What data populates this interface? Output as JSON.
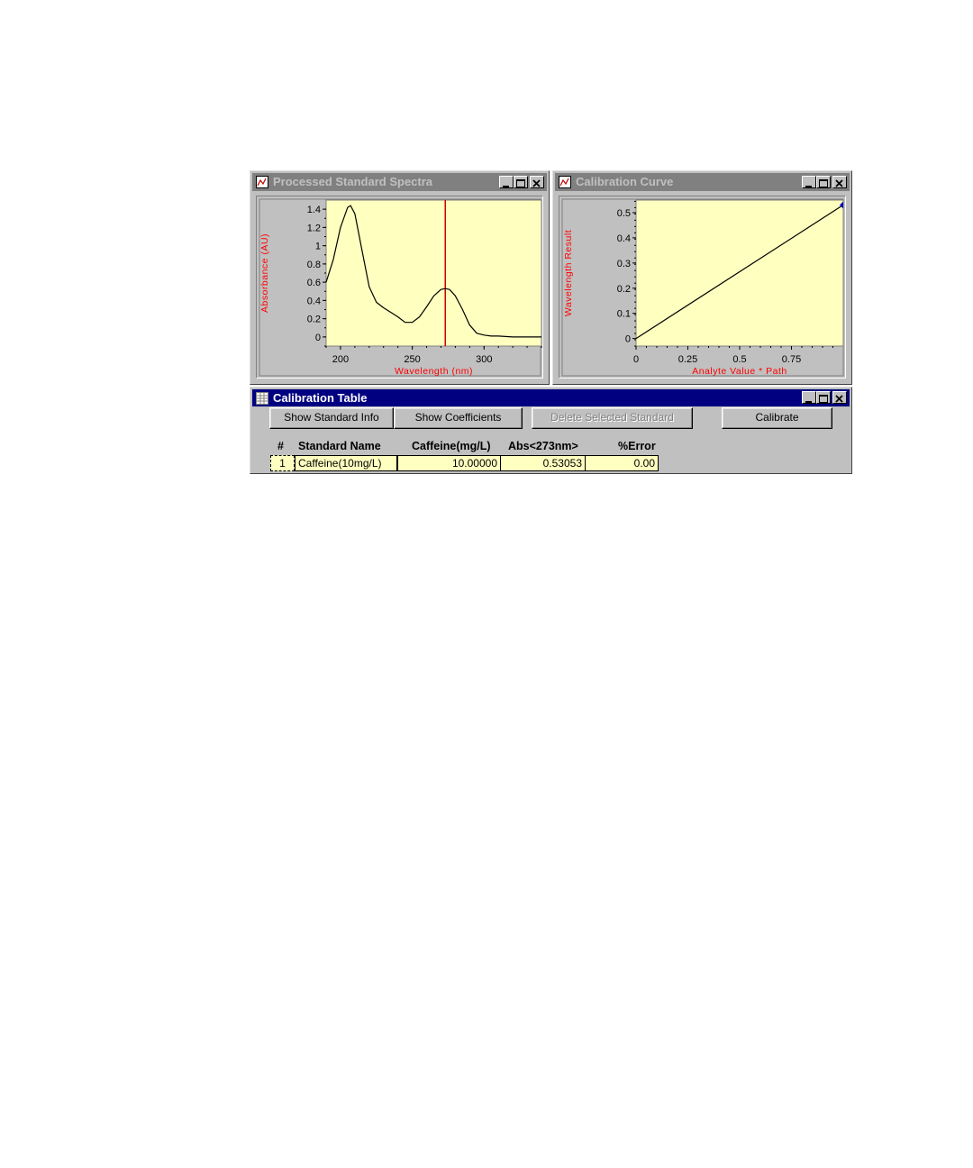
{
  "spectra_window": {
    "title": "Processed Standard Spectra",
    "chart_data": {
      "type": "line",
      "xlabel": "Wavelength (nm)",
      "ylabel": "Absorbance (AU)",
      "xlim": [
        190,
        340
      ],
      "ylim": [
        -0.1,
        1.5
      ],
      "x_ticks": [
        "200",
        "250",
        "300"
      ],
      "y_ticks": [
        "0",
        "0.2",
        "0.4",
        "0.6",
        "0.8",
        "1",
        "1.2",
        "1.4"
      ],
      "series": [
        {
          "x": [
            190,
            195,
            200,
            205,
            207,
            210,
            215,
            220,
            225,
            230,
            235,
            240,
            245,
            250,
            255,
            260,
            265,
            270,
            273,
            276,
            280,
            285,
            290,
            295,
            300,
            305,
            310,
            320,
            330,
            340
          ],
          "values": [
            0.6,
            0.85,
            1.2,
            1.42,
            1.44,
            1.35,
            0.95,
            0.55,
            0.38,
            0.32,
            0.27,
            0.22,
            0.16,
            0.16,
            0.22,
            0.33,
            0.45,
            0.52,
            0.53,
            0.52,
            0.45,
            0.3,
            0.13,
            0.04,
            0.02,
            0.01,
            0.01,
            0.0,
            0.0,
            0.0
          ]
        }
      ],
      "marker_line_x": 273,
      "grid": false
    }
  },
  "calibration_window": {
    "title": "Calibration Curve",
    "chart_data": {
      "type": "line",
      "xlabel": "Analyte Value * Path",
      "ylabel": "Wavelength Result",
      "xlim": [
        0,
        1.0
      ],
      "ylim": [
        -0.03,
        0.55
      ],
      "x_ticks": [
        "0",
        "0.25",
        "0.5",
        "0.75"
      ],
      "y_ticks": [
        "0",
        "0.1",
        "0.2",
        "0.3",
        "0.4",
        "0.5"
      ],
      "series": [
        {
          "x": [
            0,
            1.0
          ],
          "values": [
            0.0,
            0.53053
          ]
        }
      ],
      "points": [
        {
          "x": 1.0,
          "y": 0.53053
        }
      ],
      "grid": false
    }
  },
  "table_window": {
    "title": "Calibration Table",
    "buttons": {
      "show_standard_info": "Show Standard Info",
      "show_coefficients": "Show Coefficients",
      "delete_selected_standard": "Delete Selected Standard",
      "calibrate": "Calibrate"
    },
    "columns": [
      "#",
      "Standard Name",
      "Caffeine(mg/L)",
      "Abs<273nm>",
      "%Error"
    ],
    "rows": [
      {
        "num": "1",
        "name": "Caffeine(10mg/L)",
        "caffeine": "10.00000",
        "abs": "0.53053",
        "error": "0.00"
      }
    ]
  },
  "colors": {
    "plot_bg": "#ffffc0",
    "axis_label": "#ff0000",
    "marker_line": "#cc0000",
    "point": "#0000c0",
    "active_title": "#000080",
    "inactive_title": "#808080"
  }
}
